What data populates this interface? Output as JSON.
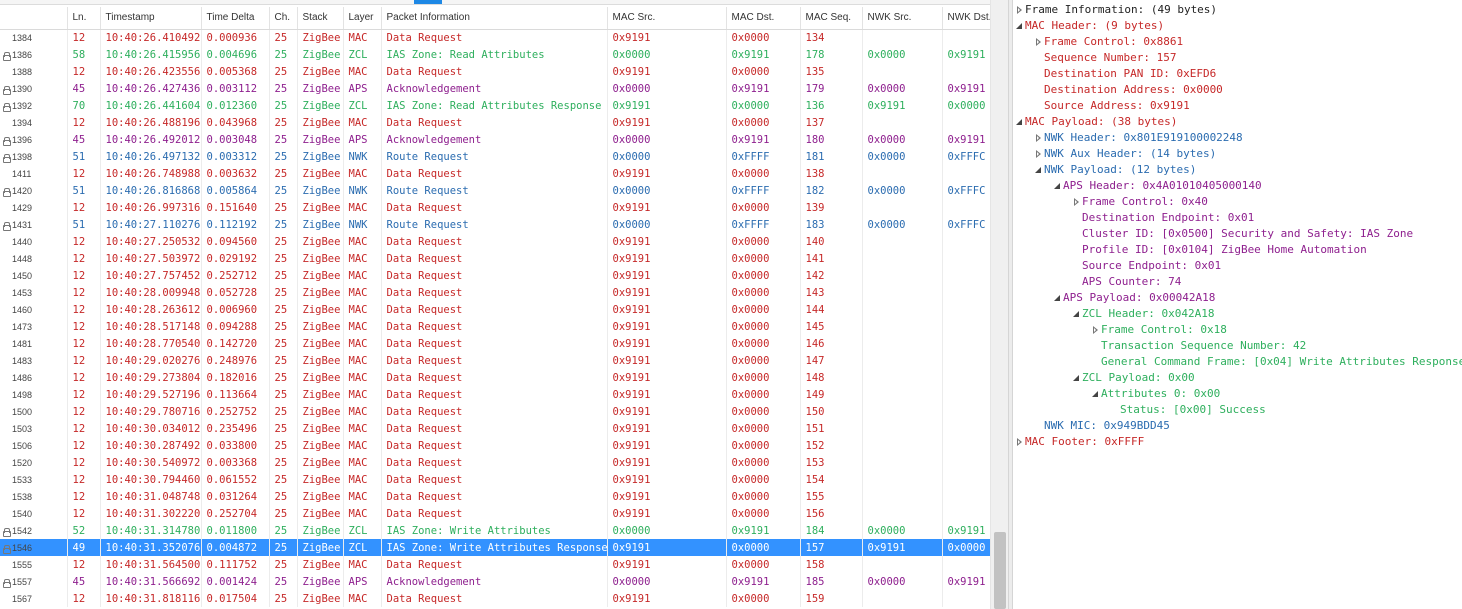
{
  "colors": {
    "mac": "#c62828",
    "zcl": "#2eaf5d",
    "aps": "#8e1f8e",
    "nwk": "#2b6cb0",
    "selection": "#3392ff"
  },
  "columns": [
    "Ln.",
    "Timestamp",
    "Time Delta",
    "Ch.",
    "Stack",
    "Layer",
    "Packet Information",
    "MAC Src.",
    "MAC Dst.",
    "MAC Seq.",
    "NWK Src.",
    "NWK Dst."
  ],
  "packets": [
    {
      "line": "1384",
      "lock": false,
      "ln": "12",
      "ts": "10:40:26.410492",
      "delta": "0.000936",
      "ch": "25",
      "stack": "ZigBee",
      "layer": "MAC",
      "info": "Data Request",
      "macSrc": "0x9191",
      "macDst": "0x0000",
      "macSeq": "134",
      "nwkSrc": "",
      "nwkDst": ""
    },
    {
      "line": "1386",
      "lock": true,
      "ln": "58",
      "ts": "10:40:26.415956",
      "delta": "0.004696",
      "ch": "25",
      "stack": "ZigBee",
      "layer": "ZCL",
      "info": "IAS Zone: Read Attributes",
      "macSrc": "0x0000",
      "macDst": "0x9191",
      "macSeq": "178",
      "nwkSrc": "0x0000",
      "nwkDst": "0x9191"
    },
    {
      "line": "1388",
      "lock": false,
      "ln": "12",
      "ts": "10:40:26.423556",
      "delta": "0.005368",
      "ch": "25",
      "stack": "ZigBee",
      "layer": "MAC",
      "info": "Data Request",
      "macSrc": "0x9191",
      "macDst": "0x0000",
      "macSeq": "135",
      "nwkSrc": "",
      "nwkDst": ""
    },
    {
      "line": "1390",
      "lock": true,
      "ln": "45",
      "ts": "10:40:26.427436",
      "delta": "0.003112",
      "ch": "25",
      "stack": "ZigBee",
      "layer": "APS",
      "info": "Acknowledgement",
      "macSrc": "0x0000",
      "macDst": "0x9191",
      "macSeq": "179",
      "nwkSrc": "0x0000",
      "nwkDst": "0x9191"
    },
    {
      "line": "1392",
      "lock": true,
      "ln": "70",
      "ts": "10:40:26.441604",
      "delta": "0.012360",
      "ch": "25",
      "stack": "ZigBee",
      "layer": "ZCL",
      "info": "IAS Zone: Read Attributes Response",
      "macSrc": "0x9191",
      "macDst": "0x0000",
      "macSeq": "136",
      "nwkSrc": "0x9191",
      "nwkDst": "0x0000"
    },
    {
      "line": "1394",
      "lock": false,
      "ln": "12",
      "ts": "10:40:26.488196",
      "delta": "0.043968",
      "ch": "25",
      "stack": "ZigBee",
      "layer": "MAC",
      "info": "Data Request",
      "macSrc": "0x9191",
      "macDst": "0x0000",
      "macSeq": "137",
      "nwkSrc": "",
      "nwkDst": ""
    },
    {
      "line": "1396",
      "lock": true,
      "ln": "45",
      "ts": "10:40:26.492012",
      "delta": "0.003048",
      "ch": "25",
      "stack": "ZigBee",
      "layer": "APS",
      "info": "Acknowledgement",
      "macSrc": "0x0000",
      "macDst": "0x9191",
      "macSeq": "180",
      "nwkSrc": "0x0000",
      "nwkDst": "0x9191"
    },
    {
      "line": "1398",
      "lock": true,
      "ln": "51",
      "ts": "10:40:26.497132",
      "delta": "0.003312",
      "ch": "25",
      "stack": "ZigBee",
      "layer": "NWK",
      "info": "Route Request",
      "macSrc": "0x0000",
      "macDst": "0xFFFF",
      "macSeq": "181",
      "nwkSrc": "0x0000",
      "nwkDst": "0xFFFC"
    },
    {
      "line": "1411",
      "lock": false,
      "ln": "12",
      "ts": "10:40:26.748988",
      "delta": "0.003632",
      "ch": "25",
      "stack": "ZigBee",
      "layer": "MAC",
      "info": "Data Request",
      "macSrc": "0x9191",
      "macDst": "0x0000",
      "macSeq": "138",
      "nwkSrc": "",
      "nwkDst": ""
    },
    {
      "line": "1420",
      "lock": true,
      "ln": "51",
      "ts": "10:40:26.816868",
      "delta": "0.005864",
      "ch": "25",
      "stack": "ZigBee",
      "layer": "NWK",
      "info": "Route Request",
      "macSrc": "0x0000",
      "macDst": "0xFFFF",
      "macSeq": "182",
      "nwkSrc": "0x0000",
      "nwkDst": "0xFFFC"
    },
    {
      "line": "1429",
      "lock": false,
      "ln": "12",
      "ts": "10:40:26.997316",
      "delta": "0.151640",
      "ch": "25",
      "stack": "ZigBee",
      "layer": "MAC",
      "info": "Data Request",
      "macSrc": "0x9191",
      "macDst": "0x0000",
      "macSeq": "139",
      "nwkSrc": "",
      "nwkDst": ""
    },
    {
      "line": "1431",
      "lock": true,
      "ln": "51",
      "ts": "10:40:27.110276",
      "delta": "0.112192",
      "ch": "25",
      "stack": "ZigBee",
      "layer": "NWK",
      "info": "Route Request",
      "macSrc": "0x0000",
      "macDst": "0xFFFF",
      "macSeq": "183",
      "nwkSrc": "0x0000",
      "nwkDst": "0xFFFC"
    },
    {
      "line": "1440",
      "lock": false,
      "ln": "12",
      "ts": "10:40:27.250532",
      "delta": "0.094560",
      "ch": "25",
      "stack": "ZigBee",
      "layer": "MAC",
      "info": "Data Request",
      "macSrc": "0x9191",
      "macDst": "0x0000",
      "macSeq": "140",
      "nwkSrc": "",
      "nwkDst": ""
    },
    {
      "line": "1448",
      "lock": false,
      "ln": "12",
      "ts": "10:40:27.503972",
      "delta": "0.029192",
      "ch": "25",
      "stack": "ZigBee",
      "layer": "MAC",
      "info": "Data Request",
      "macSrc": "0x9191",
      "macDst": "0x0000",
      "macSeq": "141",
      "nwkSrc": "",
      "nwkDst": ""
    },
    {
      "line": "1450",
      "lock": false,
      "ln": "12",
      "ts": "10:40:27.757452",
      "delta": "0.252712",
      "ch": "25",
      "stack": "ZigBee",
      "layer": "MAC",
      "info": "Data Request",
      "macSrc": "0x9191",
      "macDst": "0x0000",
      "macSeq": "142",
      "nwkSrc": "",
      "nwkDst": ""
    },
    {
      "line": "1453",
      "lock": false,
      "ln": "12",
      "ts": "10:40:28.009948",
      "delta": "0.052728",
      "ch": "25",
      "stack": "ZigBee",
      "layer": "MAC",
      "info": "Data Request",
      "macSrc": "0x9191",
      "macDst": "0x0000",
      "macSeq": "143",
      "nwkSrc": "",
      "nwkDst": ""
    },
    {
      "line": "1460",
      "lock": false,
      "ln": "12",
      "ts": "10:40:28.263612",
      "delta": "0.006960",
      "ch": "25",
      "stack": "ZigBee",
      "layer": "MAC",
      "info": "Data Request",
      "macSrc": "0x9191",
      "macDst": "0x0000",
      "macSeq": "144",
      "nwkSrc": "",
      "nwkDst": ""
    },
    {
      "line": "1473",
      "lock": false,
      "ln": "12",
      "ts": "10:40:28.517148",
      "delta": "0.094288",
      "ch": "25",
      "stack": "ZigBee",
      "layer": "MAC",
      "info": "Data Request",
      "macSrc": "0x9191",
      "macDst": "0x0000",
      "macSeq": "145",
      "nwkSrc": "",
      "nwkDst": ""
    },
    {
      "line": "1481",
      "lock": false,
      "ln": "12",
      "ts": "10:40:28.770540",
      "delta": "0.142720",
      "ch": "25",
      "stack": "ZigBee",
      "layer": "MAC",
      "info": "Data Request",
      "macSrc": "0x9191",
      "macDst": "0x0000",
      "macSeq": "146",
      "nwkSrc": "",
      "nwkDst": ""
    },
    {
      "line": "1483",
      "lock": false,
      "ln": "12",
      "ts": "10:40:29.020276",
      "delta": "0.248976",
      "ch": "25",
      "stack": "ZigBee",
      "layer": "MAC",
      "info": "Data Request",
      "macSrc": "0x9191",
      "macDst": "0x0000",
      "macSeq": "147",
      "nwkSrc": "",
      "nwkDst": ""
    },
    {
      "line": "1486",
      "lock": false,
      "ln": "12",
      "ts": "10:40:29.273804",
      "delta": "0.182016",
      "ch": "25",
      "stack": "ZigBee",
      "layer": "MAC",
      "info": "Data Request",
      "macSrc": "0x9191",
      "macDst": "0x0000",
      "macSeq": "148",
      "nwkSrc": "",
      "nwkDst": ""
    },
    {
      "line": "1498",
      "lock": false,
      "ln": "12",
      "ts": "10:40:29.527196",
      "delta": "0.113664",
      "ch": "25",
      "stack": "ZigBee",
      "layer": "MAC",
      "info": "Data Request",
      "macSrc": "0x9191",
      "macDst": "0x0000",
      "macSeq": "149",
      "nwkSrc": "",
      "nwkDst": ""
    },
    {
      "line": "1500",
      "lock": false,
      "ln": "12",
      "ts": "10:40:29.780716",
      "delta": "0.252752",
      "ch": "25",
      "stack": "ZigBee",
      "layer": "MAC",
      "info": "Data Request",
      "macSrc": "0x9191",
      "macDst": "0x0000",
      "macSeq": "150",
      "nwkSrc": "",
      "nwkDst": ""
    },
    {
      "line": "1503",
      "lock": false,
      "ln": "12",
      "ts": "10:40:30.034012",
      "delta": "0.235496",
      "ch": "25",
      "stack": "ZigBee",
      "layer": "MAC",
      "info": "Data Request",
      "macSrc": "0x9191",
      "macDst": "0x0000",
      "macSeq": "151",
      "nwkSrc": "",
      "nwkDst": ""
    },
    {
      "line": "1506",
      "lock": false,
      "ln": "12",
      "ts": "10:40:30.287492",
      "delta": "0.033800",
      "ch": "25",
      "stack": "ZigBee",
      "layer": "MAC",
      "info": "Data Request",
      "macSrc": "0x9191",
      "macDst": "0x0000",
      "macSeq": "152",
      "nwkSrc": "",
      "nwkDst": ""
    },
    {
      "line": "1520",
      "lock": false,
      "ln": "12",
      "ts": "10:40:30.540972",
      "delta": "0.003368",
      "ch": "25",
      "stack": "ZigBee",
      "layer": "MAC",
      "info": "Data Request",
      "macSrc": "0x9191",
      "macDst": "0x0000",
      "macSeq": "153",
      "nwkSrc": "",
      "nwkDst": ""
    },
    {
      "line": "1533",
      "lock": false,
      "ln": "12",
      "ts": "10:40:30.794460",
      "delta": "0.061552",
      "ch": "25",
      "stack": "ZigBee",
      "layer": "MAC",
      "info": "Data Request",
      "macSrc": "0x9191",
      "macDst": "0x0000",
      "macSeq": "154",
      "nwkSrc": "",
      "nwkDst": ""
    },
    {
      "line": "1538",
      "lock": false,
      "ln": "12",
      "ts": "10:40:31.048748",
      "delta": "0.031264",
      "ch": "25",
      "stack": "ZigBee",
      "layer": "MAC",
      "info": "Data Request",
      "macSrc": "0x9191",
      "macDst": "0x0000",
      "macSeq": "155",
      "nwkSrc": "",
      "nwkDst": ""
    },
    {
      "line": "1540",
      "lock": false,
      "ln": "12",
      "ts": "10:40:31.302220",
      "delta": "0.252704",
      "ch": "25",
      "stack": "ZigBee",
      "layer": "MAC",
      "info": "Data Request",
      "macSrc": "0x9191",
      "macDst": "0x0000",
      "macSeq": "156",
      "nwkSrc": "",
      "nwkDst": ""
    },
    {
      "line": "1542",
      "lock": true,
      "ln": "52",
      "ts": "10:40:31.314780",
      "delta": "0.011800",
      "ch": "25",
      "stack": "ZigBee",
      "layer": "ZCL",
      "info": "IAS Zone: Write Attributes",
      "macSrc": "0x0000",
      "macDst": "0x9191",
      "macSeq": "184",
      "nwkSrc": "0x0000",
      "nwkDst": "0x9191"
    },
    {
      "line": "1546",
      "lock": true,
      "ln": "49",
      "ts": "10:40:31.352076",
      "delta": "0.004872",
      "ch": "25",
      "stack": "ZigBee",
      "layer": "ZCL",
      "info": "IAS Zone: Write Attributes Response",
      "macSrc": "0x9191",
      "macDst": "0x0000",
      "macSeq": "157",
      "nwkSrc": "0x9191",
      "nwkDst": "0x0000",
      "selected": true
    },
    {
      "line": "1555",
      "lock": false,
      "ln": "12",
      "ts": "10:40:31.564500",
      "delta": "0.111752",
      "ch": "25",
      "stack": "ZigBee",
      "layer": "MAC",
      "info": "Data Request",
      "macSrc": "0x9191",
      "macDst": "0x0000",
      "macSeq": "158",
      "nwkSrc": "",
      "nwkDst": ""
    },
    {
      "line": "1557",
      "lock": true,
      "ln": "45",
      "ts": "10:40:31.566692",
      "delta": "0.001424",
      "ch": "25",
      "stack": "ZigBee",
      "layer": "APS",
      "info": "Acknowledgement",
      "macSrc": "0x0000",
      "macDst": "0x9191",
      "macSeq": "185",
      "nwkSrc": "0x0000",
      "nwkDst": "0x9191"
    },
    {
      "line": "1567",
      "lock": false,
      "ln": "12",
      "ts": "10:40:31.818116",
      "delta": "0.017504",
      "ch": "25",
      "stack": "ZigBee",
      "layer": "MAC",
      "info": "Data Request",
      "macSrc": "0x9191",
      "macDst": "0x0000",
      "macSeq": "159",
      "nwkSrc": "",
      "nwkDst": ""
    }
  ],
  "details": [
    {
      "depth": 0,
      "toggle": "closed",
      "color": "black",
      "text": "Frame Information: (49 bytes)"
    },
    {
      "depth": 0,
      "toggle": "open",
      "color": "red",
      "text": "MAC Header: (9 bytes)"
    },
    {
      "depth": 1,
      "toggle": "closed",
      "color": "red",
      "text": "Frame Control: 0x8861"
    },
    {
      "depth": 1,
      "toggle": "none",
      "color": "red",
      "text": "Sequence Number: 157"
    },
    {
      "depth": 1,
      "toggle": "none",
      "color": "red",
      "text": "Destination PAN ID: 0xEFD6"
    },
    {
      "depth": 1,
      "toggle": "none",
      "color": "red",
      "text": "Destination Address: 0x0000"
    },
    {
      "depth": 1,
      "toggle": "none",
      "color": "red",
      "text": "Source Address: 0x9191"
    },
    {
      "depth": 0,
      "toggle": "open",
      "color": "red",
      "text": "MAC Payload: (38 bytes)"
    },
    {
      "depth": 1,
      "toggle": "closed",
      "color": "blue",
      "text": "NWK Header: 0x801E919100002248"
    },
    {
      "depth": 1,
      "toggle": "closed",
      "color": "blue",
      "text": "NWK Aux Header: (14 bytes)"
    },
    {
      "depth": 1,
      "toggle": "open",
      "color": "blue",
      "text": "NWK Payload: (12 bytes)"
    },
    {
      "depth": 2,
      "toggle": "open",
      "color": "purple",
      "text": "APS Header: 0x4A01010405000140"
    },
    {
      "depth": 3,
      "toggle": "closed",
      "color": "purple",
      "text": "Frame Control: 0x40"
    },
    {
      "depth": 3,
      "toggle": "none",
      "color": "purple",
      "text": "Destination Endpoint: 0x01"
    },
    {
      "depth": 3,
      "toggle": "none",
      "color": "purple",
      "text": "Cluster ID: [0x0500] Security and Safety: IAS Zone"
    },
    {
      "depth": 3,
      "toggle": "none",
      "color": "purple",
      "text": "Profile ID: [0x0104] ZigBee Home Automation"
    },
    {
      "depth": 3,
      "toggle": "none",
      "color": "purple",
      "text": "Source Endpoint: 0x01"
    },
    {
      "depth": 3,
      "toggle": "none",
      "color": "purple",
      "text": "APS Counter: 74"
    },
    {
      "depth": 2,
      "toggle": "open",
      "color": "purple",
      "text": "APS Payload: 0x00042A18"
    },
    {
      "depth": 3,
      "toggle": "open",
      "color": "green",
      "text": "ZCL Header: 0x042A18"
    },
    {
      "depth": 4,
      "toggle": "closed",
      "color": "green",
      "text": "Frame Control: 0x18"
    },
    {
      "depth": 4,
      "toggle": "none",
      "color": "green",
      "text": "Transaction Sequence Number: 42"
    },
    {
      "depth": 4,
      "toggle": "none",
      "color": "green",
      "text": "General Command Frame: [0x04] Write Attributes Response"
    },
    {
      "depth": 3,
      "toggle": "open",
      "color": "green",
      "text": "ZCL Payload: 0x00"
    },
    {
      "depth": 4,
      "toggle": "open",
      "color": "green",
      "text": "Attributes 0: 0x00"
    },
    {
      "depth": 5,
      "toggle": "none",
      "color": "green",
      "text": "Status: [0x00] Success"
    },
    {
      "depth": 1,
      "toggle": "none",
      "color": "blue",
      "text": "NWK MIC: 0x949BDD45"
    },
    {
      "depth": 0,
      "toggle": "closed",
      "color": "red",
      "text": "MAC Footer: 0xFFFF"
    }
  ]
}
